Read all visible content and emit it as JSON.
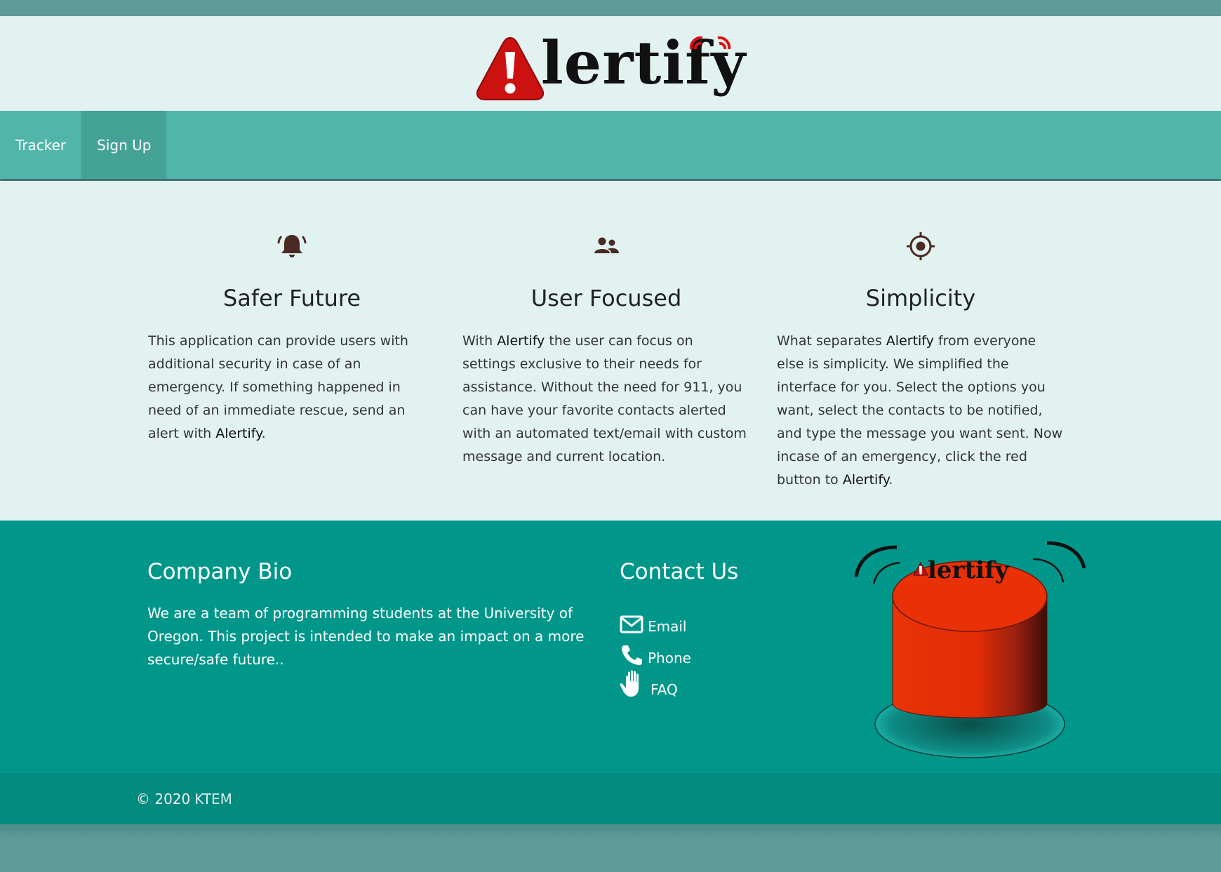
{
  "brand": {
    "name": "Alertify",
    "logo_text": "lertify"
  },
  "nav": {
    "items": [
      "Tracker",
      "Sign Up"
    ]
  },
  "features": [
    {
      "icon": "bell-icon",
      "title": "Safer Future",
      "text_before": "This application can provide users with additional security in case of an emergency. If something happened in need of an immediate rescue, send an alert with ",
      "brand": "Alertify",
      "text_after": "."
    },
    {
      "icon": "users-icon",
      "title": "User Focused",
      "text_before": "With ",
      "brand": "Alertify",
      "text_after": " the user can focus on settings exclusive to their needs for assistance. Without the need for 911, you can have your favorite contacts alerted with an automated text/email with custom message and current location."
    },
    {
      "icon": "crosshair-icon",
      "title": "Simplicity",
      "text_before": "What separates ",
      "brand": "Alertify",
      "text_after": " from everyone else is simplicity. We simplified the interface for you. Select the options you want, select the contacts to be notified, and type the message you want sent. Now incase of an emergency, click the red button to ",
      "brand2": "Alertify",
      "text_end": "."
    }
  ],
  "footer": {
    "bio_title": "Company Bio",
    "bio_text": "We are a team of programming students at the University of Oregon. This project is intended to make an impact on a more secure/safe future..",
    "contact_title": "Contact Us",
    "contacts": [
      {
        "icon": "mail-icon",
        "label": "Email"
      },
      {
        "icon": "phone-icon",
        "label": "Phone"
      },
      {
        "icon": "hand-icon",
        "label": "FAQ"
      }
    ]
  },
  "copyright": {
    "prefix": "© 2020",
    "link": "KTEM"
  },
  "colors": {
    "header_bg": "#e2f2f1",
    "nav_bg": "#51b5aa",
    "nav_active": "#45a296",
    "footer_bg": "#00978a",
    "copyright_bg": "#008b7e",
    "alert_red": "#cc1111",
    "button_red": "#e32a08"
  }
}
